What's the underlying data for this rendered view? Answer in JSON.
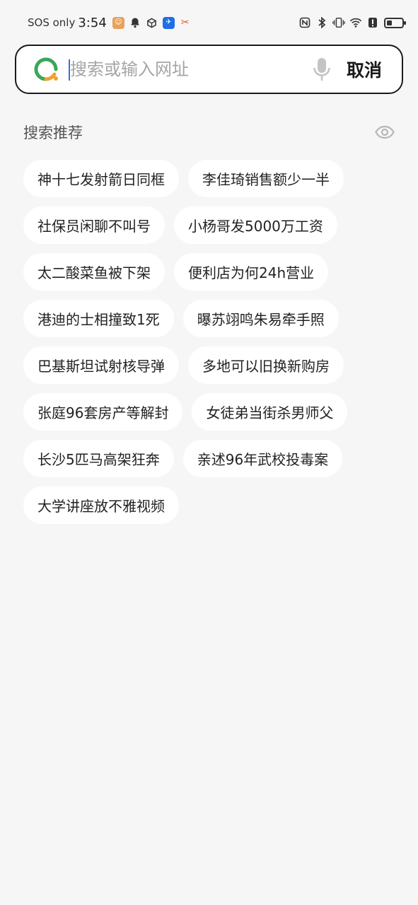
{
  "status_bar": {
    "carrier": "SOS only",
    "time": "3:54"
  },
  "search": {
    "placeholder": "搜索或输入网址",
    "value": "",
    "cancel_label": "取消"
  },
  "suggestions": {
    "title": "搜索推荐",
    "rows": [
      [
        "神十七发射箭日同框",
        "李佳琦销售额少一半"
      ],
      [
        "社保员闲聊不叫号",
        "小杨哥发5000万工资"
      ],
      [
        "太二酸菜鱼被下架",
        "便利店为何24h营业"
      ],
      [
        "港迪的士相撞致1死",
        "曝苏翊鸣朱易牵手照"
      ],
      [
        "巴基斯坦试射核导弹",
        "多地可以旧换新购房"
      ],
      [
        "张庭96套房产等解封",
        "女徒弟当街杀男师父"
      ],
      [
        "长沙5匹马高架狂奔",
        "亲述96年武校投毒案"
      ],
      [
        "大学讲座放不雅视频"
      ]
    ]
  },
  "colors": {
    "background": "#f6f6f6",
    "chip_background": "#ffffff",
    "search_border": "#1a1a1a",
    "logo_green": "#3aa757",
    "logo_orange": "#f0a12f",
    "caret_blue": "#3b6fd6"
  }
}
